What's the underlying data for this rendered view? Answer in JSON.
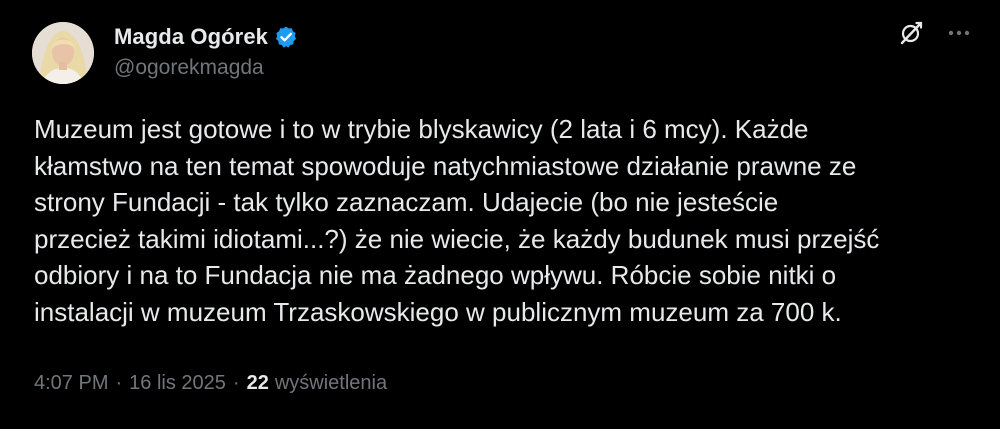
{
  "author": {
    "display_name": "Magda Ogórek",
    "handle": "@ogorekmagda"
  },
  "tweet": {
    "lines": [
      "Muzeum jest gotowe i to w trybie blyskawicy (2 lata i 6 mcy). Każde",
      "kłamstwo na ten temat spowoduje natychmiastowe działanie prawne ze",
      "strony Fundacji - tak tylko zaznaczam. Udajecie (bo nie jesteście",
      "przecież takimi idiotami...?) że nie wiecie, że każdy budunek musi przejść",
      "odbiory i na to Fundacja nie ma żadnego wpływu. Róbcie sobie nitki o",
      "instalacji w muzeum Trzaskowskiego w publicznym muzeum za 700 k."
    ]
  },
  "meta": {
    "time": "4:07 PM",
    "separator": "·",
    "date": "16 lis 2025",
    "views_count": "22",
    "views_label": "wyświetlenia"
  },
  "icons": {
    "verified": "verified-badge-icon",
    "grok": "grok-icon",
    "more": "more-icon"
  },
  "colors": {
    "background": "#000000",
    "text_primary": "#e7e9ea",
    "text_secondary": "#71767b",
    "verified_blue": "#1d9bf0"
  }
}
